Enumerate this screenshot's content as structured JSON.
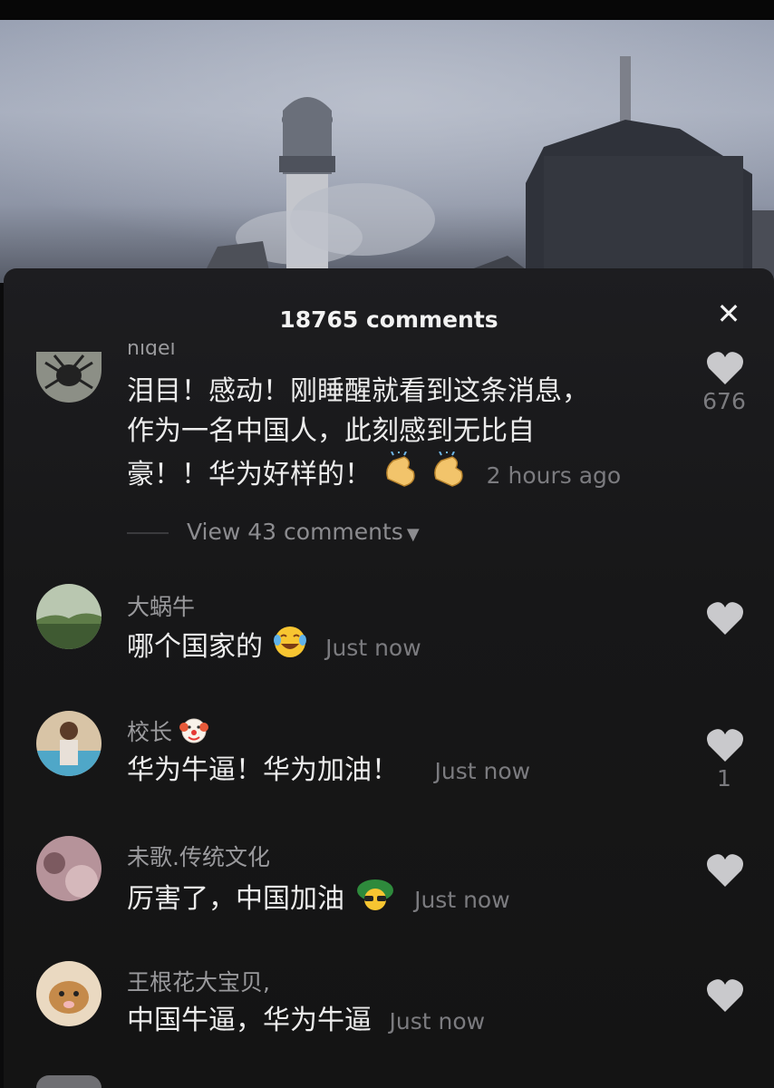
{
  "panel": {
    "title": "18765 comments",
    "close_label": "✕"
  },
  "comments": [
    {
      "username": "nigel",
      "lines": [
        "泪目！感动！刚睡醒就看到这条消息，",
        "作为一名中国人，此刻感到无比自",
        "豪！！华为好样的！"
      ],
      "emojis": [
        "clapping-hands-emoji",
        "clapping-hands-emoji"
      ],
      "time": "2 hours ago",
      "likes": "676",
      "view_more": "View 43 comments"
    },
    {
      "username": "大蜗牛",
      "text": "哪个国家的",
      "emojis": [
        "laughing-tears-emoji"
      ],
      "time": "Just now",
      "likes": ""
    },
    {
      "username": "校长",
      "username_emoji": "clown-face-emoji",
      "text": "华为牛逼！华为加油！",
      "time": "Just now",
      "likes": "1"
    },
    {
      "username": "未歌.传统文化",
      "text": "厉害了，中国加油",
      "emojis": [
        "sunglasses-turtle-emoji"
      ],
      "time": "Just now",
      "likes": ""
    },
    {
      "username": "王根花大宝贝,",
      "text": "中国牛逼，华为牛逼",
      "time": "Just now",
      "likes": ""
    }
  ],
  "colors": {
    "panel_bg": "#1a1a1c",
    "text_primary": "#ececec",
    "text_secondary": "#7b7b7f",
    "heart": "#c9c9cc"
  }
}
